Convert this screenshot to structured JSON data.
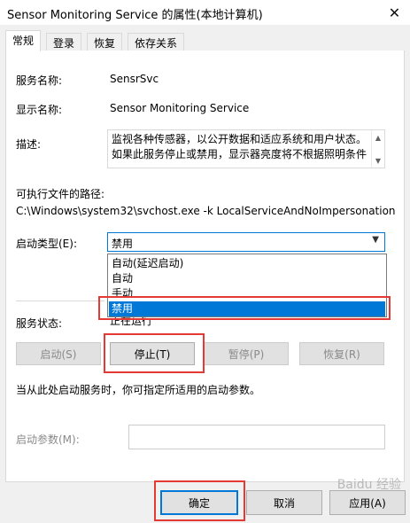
{
  "window": {
    "title": "Sensor Monitoring Service 的属性(本地计算机)",
    "close_glyph": "✕"
  },
  "tabs": [
    {
      "label": "常规",
      "active": true
    },
    {
      "label": "登录",
      "active": false
    },
    {
      "label": "恢复",
      "active": false
    },
    {
      "label": "依存关系",
      "active": false
    }
  ],
  "general": {
    "service_name_label": "服务名称:",
    "service_name": "SensrSvc",
    "display_name_label": "显示名称:",
    "display_name": "Sensor Monitoring Service",
    "description_label": "描述:",
    "description": "监视各种传感器，以公开数据和适应系统和用户状态。如果此服务停止或禁用，显示器亮度将不根据照明条件",
    "exe_path_label": "可执行文件的路径:",
    "exe_path": "C:\\Windows\\system32\\svchost.exe -k LocalServiceAndNoImpersonation",
    "startup_type_label": "启动类型(E):",
    "startup_type_value": "禁用",
    "startup_options": [
      "自动(延迟启动)",
      "自动",
      "手动",
      "禁用"
    ],
    "status_label": "服务状态:",
    "status_value": "正在运行",
    "start_hint": "当从此处启动服务时，你可指定所适用的启动参数。",
    "start_params_label": "启动参数(M):",
    "start_params_value": ""
  },
  "service_buttons": {
    "start": "启动(S)",
    "stop": "停止(T)",
    "pause": "暂停(P)",
    "resume": "恢复(R)"
  },
  "dialog_buttons": {
    "ok": "确定",
    "cancel": "取消",
    "apply": "应用(A)"
  },
  "watermark": "Baidu 经验",
  "colors": {
    "accent": "#0078d7",
    "highlight": "#e53935"
  },
  "icons": {
    "dropdown_arrow": "chevron-down-icon",
    "scroll_up": "scroll-up-icon",
    "scroll_down": "scroll-down-icon",
    "close": "close-icon"
  }
}
